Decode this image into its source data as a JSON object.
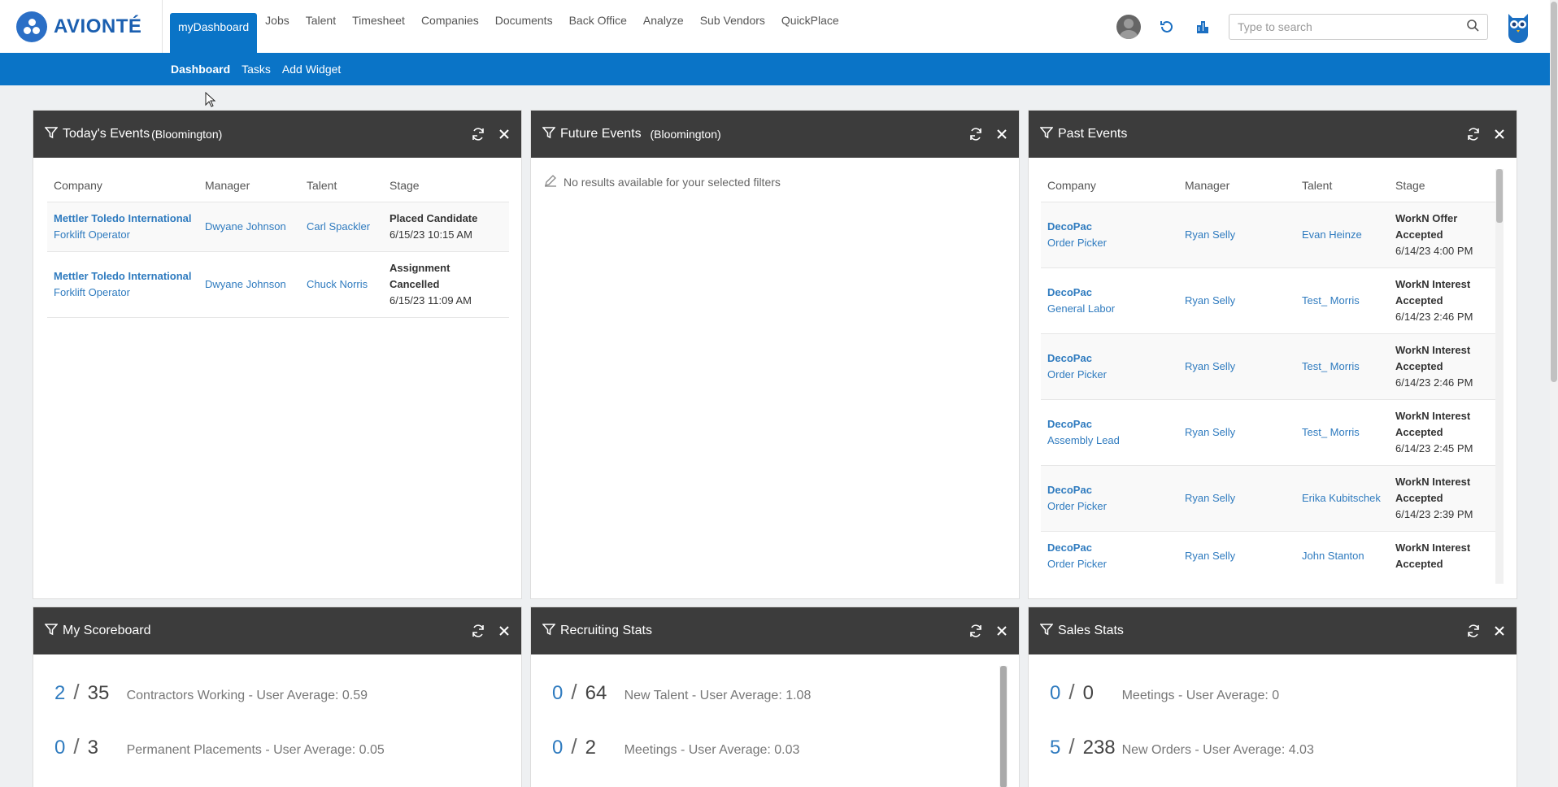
{
  "brand": {
    "name": "AVIONTÉ"
  },
  "nav": [
    {
      "label": "myDashboard",
      "active": true
    },
    {
      "label": "Jobs"
    },
    {
      "label": "Talent"
    },
    {
      "label": "Timesheet"
    },
    {
      "label": "Companies"
    },
    {
      "label": "Documents"
    },
    {
      "label": "Back Office"
    },
    {
      "label": "Analyze"
    },
    {
      "label": "Sub Vendors"
    },
    {
      "label": "QuickPlace"
    }
  ],
  "search": {
    "placeholder": "Type to search"
  },
  "subnav": [
    {
      "label": "Dashboard",
      "active": true
    },
    {
      "label": "Tasks"
    },
    {
      "label": "Add Widget"
    }
  ],
  "colors": {
    "accent": "#0a74c7",
    "header": "#3c3c3c",
    "link": "#2f7bbf"
  },
  "todays_events": {
    "title": "Today's Events",
    "location": "(Bloomington)",
    "columns": [
      "Company",
      "Manager",
      "Talent",
      "Stage"
    ],
    "rows": [
      {
        "company": "Mettler Toledo International",
        "position": "Forklift Operator",
        "manager": "Dwyane Johnson",
        "talent": "Carl Spackler",
        "stage": "Placed Candidate",
        "date": "6/15/23 10:15 AM"
      },
      {
        "company": "Mettler Toledo International",
        "position": "Forklift Operator",
        "manager": "Dwyane Johnson",
        "talent": "Chuck Norris",
        "stage": "Assignment Cancelled",
        "date": "6/15/23 11:09 AM"
      }
    ]
  },
  "future_events": {
    "title": "Future Events",
    "location": "(Bloomington)",
    "empty": "No results available for your selected filters"
  },
  "past_events": {
    "title": "Past Events",
    "columns": [
      "Company",
      "Manager",
      "Talent",
      "Stage"
    ],
    "rows": [
      {
        "company": "DecoPac",
        "position": "Order Picker",
        "manager": "Ryan Selly",
        "talent": "Evan Heinze",
        "stage": "WorkN Offer Accepted",
        "date": "6/14/23 4:00 PM"
      },
      {
        "company": "DecoPac",
        "position": "General Labor",
        "manager": "Ryan Selly",
        "talent": "Test_ Morris",
        "stage": "WorkN Interest Accepted",
        "date": "6/14/23 2:46 PM"
      },
      {
        "company": "DecoPac",
        "position": "Order Picker",
        "manager": "Ryan Selly",
        "talent": "Test_ Morris",
        "stage": "WorkN Interest Accepted",
        "date": "6/14/23 2:46 PM"
      },
      {
        "company": "DecoPac",
        "position": "Assembly Lead",
        "manager": "Ryan Selly",
        "talent": "Test_ Morris",
        "stage": "WorkN Interest Accepted",
        "date": "6/14/23 2:45 PM"
      },
      {
        "company": "DecoPac",
        "position": "Order Picker",
        "manager": "Ryan Selly",
        "talent": "Erika Kubitschek",
        "stage": "WorkN Interest Accepted",
        "date": "6/14/23 2:39 PM"
      },
      {
        "company": "DecoPac",
        "position": "Order Picker",
        "manager": "Ryan Selly",
        "talent": "John Stanton",
        "stage": "WorkN Interest Accepted",
        "date": ""
      }
    ]
  },
  "my_scoreboard": {
    "title": "My Scoreboard",
    "stats": [
      {
        "value": "2",
        "total": "35",
        "label": "Contractors Working - User Average: 0.59"
      },
      {
        "value": "0",
        "total": "3",
        "label": "Permanent Placements - User Average: 0.05"
      }
    ]
  },
  "recruiting_stats": {
    "title": "Recruiting Stats",
    "stats": [
      {
        "value": "0",
        "total": "64",
        "label": "New Talent - User Average: 1.08"
      },
      {
        "value": "0",
        "total": "2",
        "label": "Meetings - User Average: 0.03"
      }
    ]
  },
  "sales_stats": {
    "title": "Sales Stats",
    "stats": [
      {
        "value": "0",
        "total": "0",
        "label": "Meetings - User Average: 0"
      },
      {
        "value": "5",
        "total": "238",
        "label": "New Orders - User Average: 4.03"
      }
    ]
  }
}
